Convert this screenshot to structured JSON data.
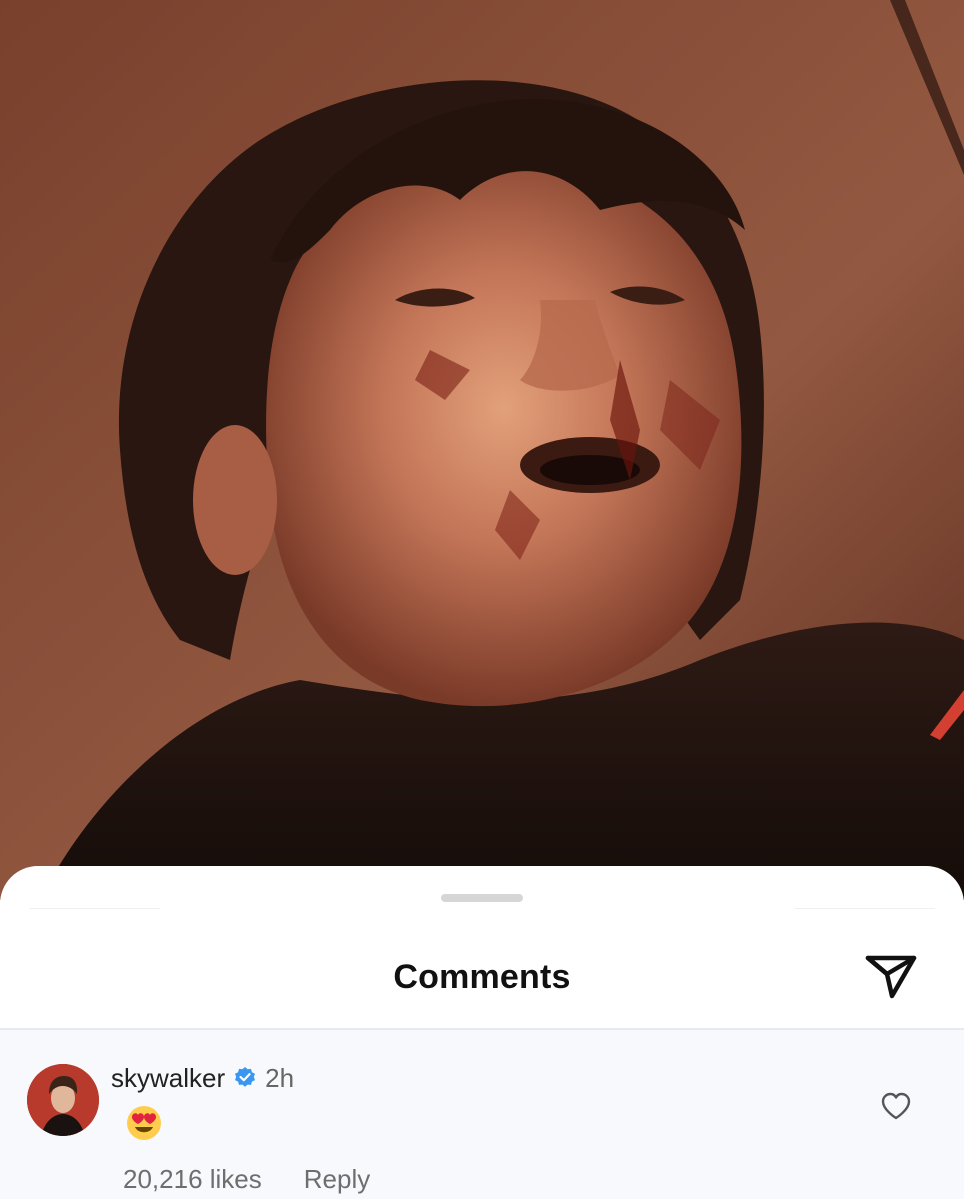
{
  "post": {
    "image_subject": "film-still-photo"
  },
  "sheet": {
    "title": "Comments",
    "share_icon": "paper-plane-icon"
  },
  "comment": {
    "username": "skywalker",
    "verified": true,
    "verified_icon": "verified-badge-icon",
    "timestamp": "2h",
    "emoji": "😍",
    "emoji_icon": "heart-eyes-emoji-icon",
    "likes": "20,216 likes",
    "reply_label": "Reply",
    "like_icon": "heart-outline-icon"
  },
  "colors": {
    "background": "#ffffff",
    "comment_bg": "#f7f9fd",
    "verified_blue": "#3897f0",
    "text_primary": "#111111",
    "text_secondary": "#6e6e6e"
  }
}
